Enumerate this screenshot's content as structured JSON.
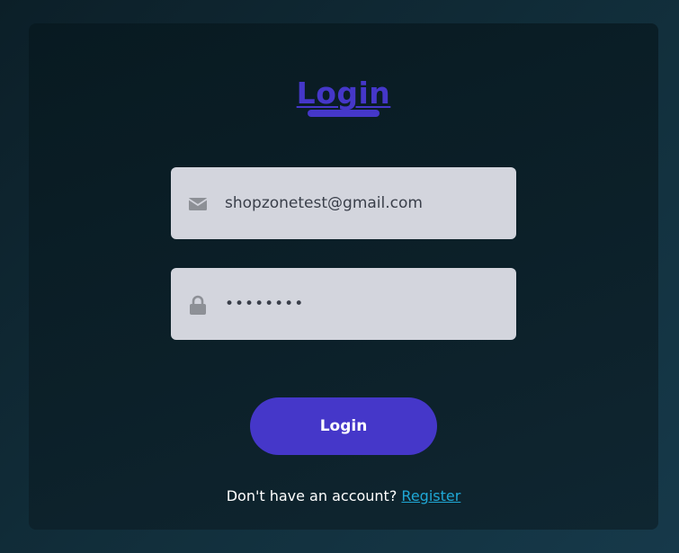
{
  "login_form": {
    "title": "Login",
    "email": {
      "value": "shopzonetest@gmail.com",
      "icon": "envelope-icon"
    },
    "password": {
      "value": "••••••••",
      "icon": "lock-icon"
    },
    "submit_label": "Login",
    "register_prompt": "Don't have an account?",
    "register_link": "Register"
  },
  "colors": {
    "accent": "#4537c9",
    "link": "#1fa8d6",
    "field_background": "#d3d5dd",
    "card_background": "#0c2029"
  }
}
